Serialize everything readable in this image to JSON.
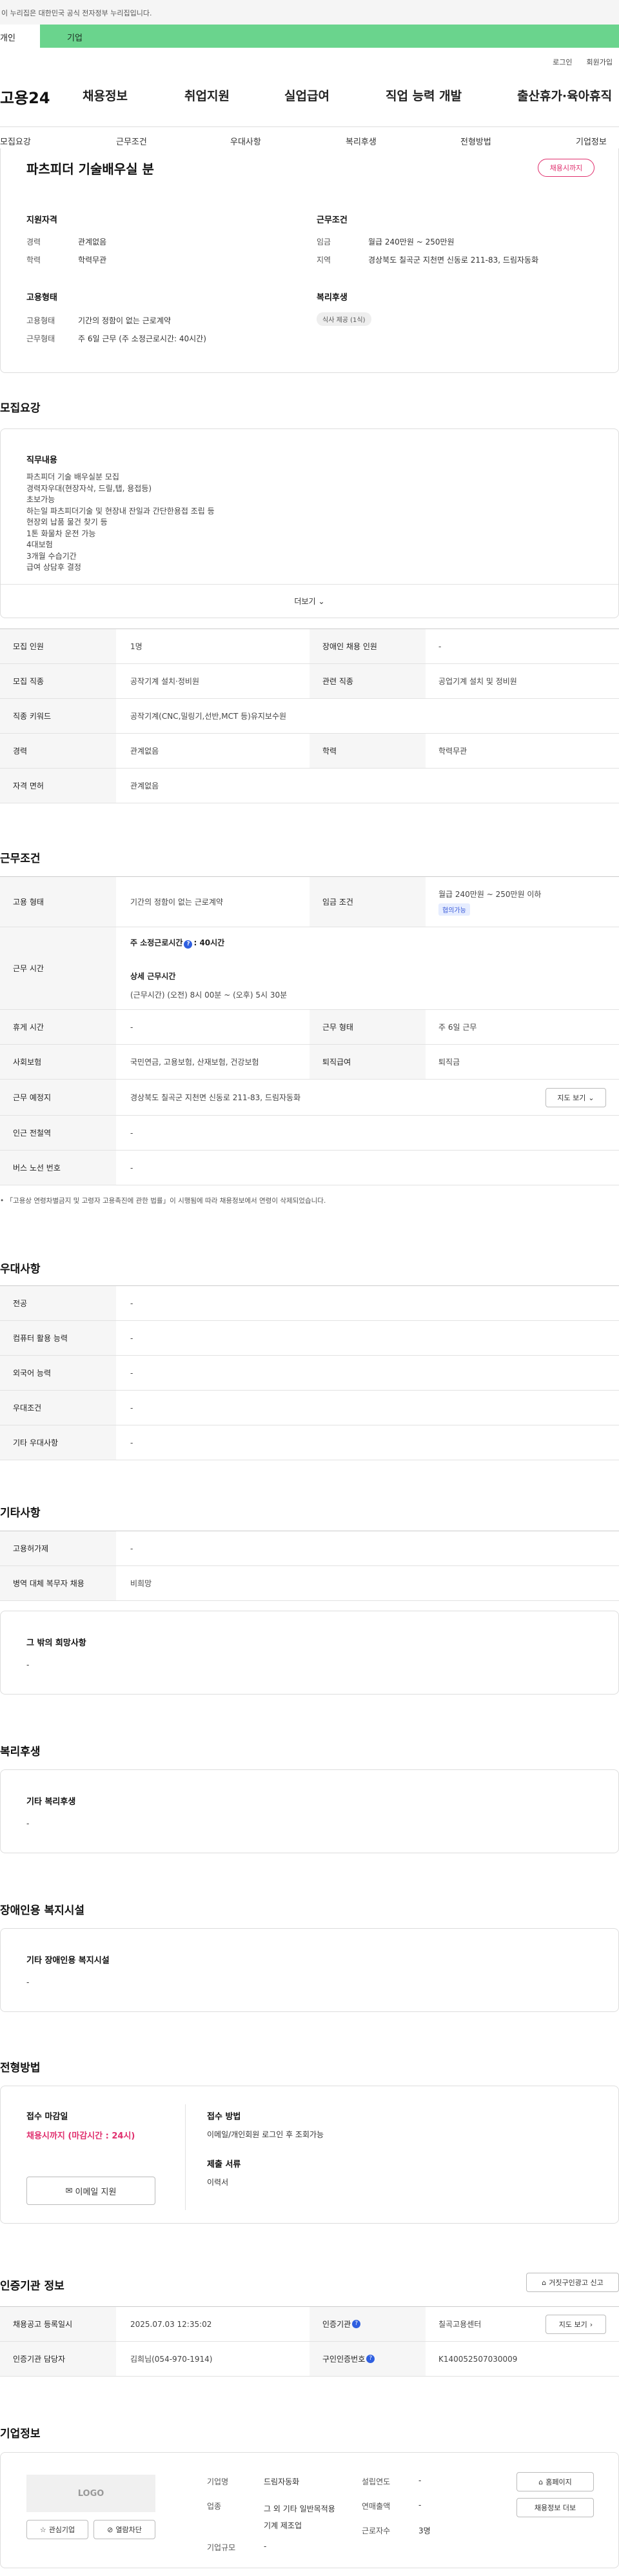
{
  "gov_banner": "이 누리집은 대한민국 공식 전자정부 누리집입니다.",
  "tabs": {
    "individual": "개인",
    "company": "기업"
  },
  "util": {
    "login": "로그인",
    "join": "회원가입"
  },
  "gnb": {
    "logo": "고용24",
    "menu": [
      "채용정보",
      "취업지원",
      "실업급여",
      "직업 능력 개발",
      "출산휴가·육아휴직"
    ]
  },
  "subnav": [
    "모집요강",
    "근무조건",
    "우대사항",
    "복리후생",
    "전형방법",
    "기업정보"
  ],
  "summary": {
    "title": "파츠피더 기술배우실 분",
    "deadline_badge": "채용시까지",
    "qual_title": "지원자격",
    "qual": [
      {
        "k": "경력",
        "v": "관계없음"
      },
      {
        "k": "학력",
        "v": "학력무관"
      }
    ],
    "cond_title": "근무조건",
    "cond": [
      {
        "k": "임금",
        "v": "월급 240만원 ~ 250만원"
      },
      {
        "k": "지역",
        "v": "경상북도 칠곡군 지천면 신동로 211-83, 드림자동화"
      }
    ],
    "emp_title": "고용형태",
    "emp": [
      {
        "k": "고용형태",
        "v": "기간의 정함이 없는 근로계약"
      },
      {
        "k": "근무형태",
        "v": "주 6일 근무 (주 소정근로시간: 40시간)"
      }
    ],
    "welfare_title": "복리후생",
    "welfare_tag": "식사 제공 (1식)"
  },
  "recruit": {
    "heading": "모집요강",
    "job_title": "직무내용",
    "job_lines": [
      "파츠피더 기술 배우실분 모집",
      "경력자우대(현장자삭, 드릴,탭, 용접등)",
      "초보가능",
      "하는일 파츠피더기술 및 현장내 잔일과 간단한용접 조립 등",
      "현장외 납품 물건 찾기 등",
      "1톤 화물차 운전 가능",
      "4대보험",
      "3개월 수습기간",
      "급여 상담후 결정"
    ],
    "more": "더보기",
    "rows": [
      {
        "k": "모집 인원",
        "v": "1명",
        "k2": "장애인 채용 인원",
        "v2": "-"
      },
      {
        "k": "모집 직종",
        "v": "공작기계 설치·정비원",
        "k2": "관련 직종",
        "v2": "공업기계 설치 및 정비원"
      },
      {
        "k": "직종 키워드",
        "v": "공작기계(CNC,밀링기,선반,MCT 등)유지보수원"
      },
      {
        "k": "경력",
        "v": "관계없음",
        "k2": "학력",
        "v2": "학력무관"
      },
      {
        "k": "자격 면허",
        "v": "관계없음"
      }
    ]
  },
  "conditions": {
    "heading": "근무조건",
    "emp_type_k": "고용 형태",
    "emp_type_v": "기간의 정함이 없는 근로계약",
    "wage_k": "임금 조건",
    "wage_v": "월급 240만원 ~ 250만원 이하",
    "wage_tag": "협의가능",
    "hours_k": "근무 시간",
    "hours_weekly_label": "주 소정근로시간",
    "hours_weekly_val": ": 40시간",
    "hours_detail_title": "상세 근무시간",
    "hours_detail_val": "(근무시간) (오전) 8시 00분 ~ (오후) 5시 30분",
    "rows": [
      {
        "k": "휴게 시간",
        "v": "-",
        "k2": "근무 형태",
        "v2": "주 6일 근무"
      },
      {
        "k": "사회보험",
        "v": "국민연금, 고용보험, 산재보험, 건강보험",
        "k2": "퇴직급여",
        "v2": "퇴직금"
      }
    ],
    "place_k": "근무 예정지",
    "place_v": "경상북도 칠곡군 지천면 신동로 211-83, 드림자동화",
    "map_btn": "지도 보기",
    "rows2": [
      {
        "k": "인근 전철역",
        "v": "-"
      },
      {
        "k": "버스 노선 번호",
        "v": "-"
      }
    ],
    "note": "「고용상 연령차별금지 및 고령자 고용촉진에 관한 법률」이 시행됨에 따라 채용정보에서 연령이 삭제되었습니다."
  },
  "preference": {
    "heading": "우대사항",
    "rows": [
      {
        "k": "전공",
        "v": "-"
      },
      {
        "k": "컴퓨터 활용 능력",
        "v": "-"
      },
      {
        "k": "외국어 능력",
        "v": "-"
      },
      {
        "k": "우대조건",
        "v": "-"
      },
      {
        "k": "기타 우대사항",
        "v": "-"
      }
    ]
  },
  "etc": {
    "heading": "기타사항",
    "rows": [
      {
        "k": "고용허가제",
        "v": "-"
      },
      {
        "k": "병역 대체 복무자 채용",
        "v": "비희망"
      }
    ],
    "hope_title": "그 밖의 희망사항",
    "hope_val": "-"
  },
  "welfare": {
    "heading": "복리후생",
    "title": "기타 복리후생",
    "val": "-"
  },
  "disabled": {
    "heading": "장애인용 복지시설",
    "title": "기타 장애인용 복지시설",
    "val": "-"
  },
  "screening": {
    "heading": "전형방법",
    "deadline_title": "접수 마감일",
    "deadline_val": "채용시까지 (마감시간 : 24시)",
    "email_btn": "이메일 지원",
    "method_title": "접수 방법",
    "method_val": "이메일/개인회원 로그인 후 조회가능",
    "docs_title": "제출 서류",
    "docs_val": "이력서"
  },
  "cert": {
    "heading": "인증기관 정보",
    "report_btn": "거짓구인광고 신고",
    "rows": [
      {
        "k": "채용공고 등록일시",
        "v": "2025.07.03 12:35:02",
        "k2": "인증기관",
        "v2": "칠곡고용센터",
        "btn": "지도 보기"
      },
      {
        "k": "인증기관 담당자",
        "v": "김희님(054-970-1914)",
        "k2": "구인인증번호",
        "v2": "K140052507030009"
      }
    ]
  },
  "company": {
    "heading": "기업정보",
    "logo": "LOGO",
    "fav_btn": "관심기업",
    "block_btn": "열람차단",
    "home_btn": "홈페이지",
    "jobs_btn": "채용정보 더보",
    "info": [
      {
        "k": "기업명",
        "v": "드림자동화"
      },
      {
        "k": "업종",
        "v": "그 외 기타 일반목적용 기계 제조업"
      },
      {
        "k": "기업규모",
        "v": "-"
      }
    ],
    "info2": [
      {
        "k": "설립연도",
        "v": "-"
      },
      {
        "k": "연매출액",
        "v": "-"
      },
      {
        "k": "근로자수",
        "v": "3명"
      }
    ]
  }
}
